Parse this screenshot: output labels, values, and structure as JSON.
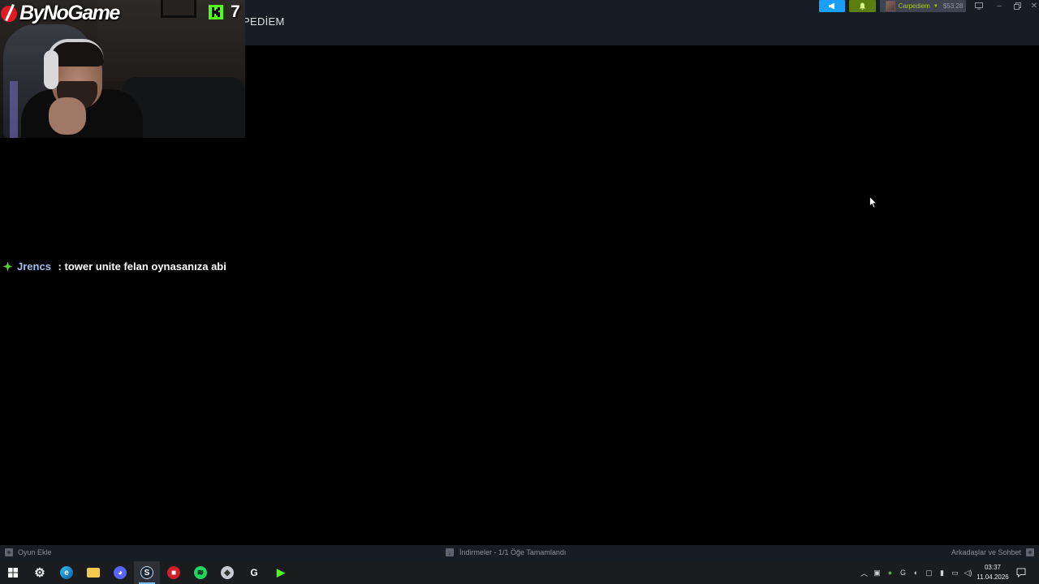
{
  "steam": {
    "header_title": "PEDİEM",
    "user": {
      "name": "Carpediem",
      "wallet": "$53.28"
    },
    "bottom_bar": {
      "add_game": "Oyun Ekle",
      "downloads": "İndirmeler - 1/1 Öğe Tamamlandı",
      "friends_chat": "Arkadaşlar ve Sohbet"
    }
  },
  "overlay": {
    "logo_text": "ByNoGame",
    "viewer_count": "7",
    "chat": {
      "username": "Jrencs",
      "separator": " : ",
      "message": "tower unite felan oynasanıza abi"
    }
  },
  "taskbar": {
    "apps": [
      "start",
      "settings",
      "edge",
      "file-explorer",
      "discord",
      "steam",
      "app-red",
      "spotify",
      "app-logitech",
      "app-g",
      "app-kick"
    ],
    "active_app": "steam",
    "clock": {
      "time": "03:37",
      "date": "11.04.2026"
    }
  },
  "colors": {
    "steam_header_bg": "#171d25",
    "announce_blue": "#1a9fff",
    "notif_green": "#5c7e10",
    "username_green": "#a4d007",
    "chat_username": "#9ec1ee",
    "kick_green": "#53fc18"
  },
  "icons": {
    "announcements": "megaphone-icon",
    "notifications": "bell-icon",
    "chat_badge": "green-star-badge-icon",
    "cursor": "mouse-pointer-icon"
  }
}
